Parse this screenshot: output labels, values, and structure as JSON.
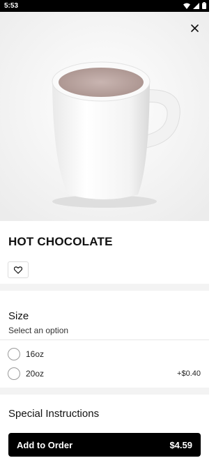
{
  "status_bar": {
    "time": "5:53"
  },
  "item": {
    "title": "HOT CHOCOLATE"
  },
  "size_section": {
    "title": "Size",
    "subtitle": "Select an option",
    "options": [
      {
        "label": "16oz",
        "price": ""
      },
      {
        "label": "20oz",
        "price": "+$0.40"
      }
    ]
  },
  "instructions_section": {
    "title": "Special Instructions"
  },
  "cta": {
    "label": "Add to Order",
    "price": "$4.59"
  },
  "icons": [
    "wifi-icon",
    "signal-icon",
    "battery-icon",
    "close-icon",
    "heart-icon"
  ]
}
